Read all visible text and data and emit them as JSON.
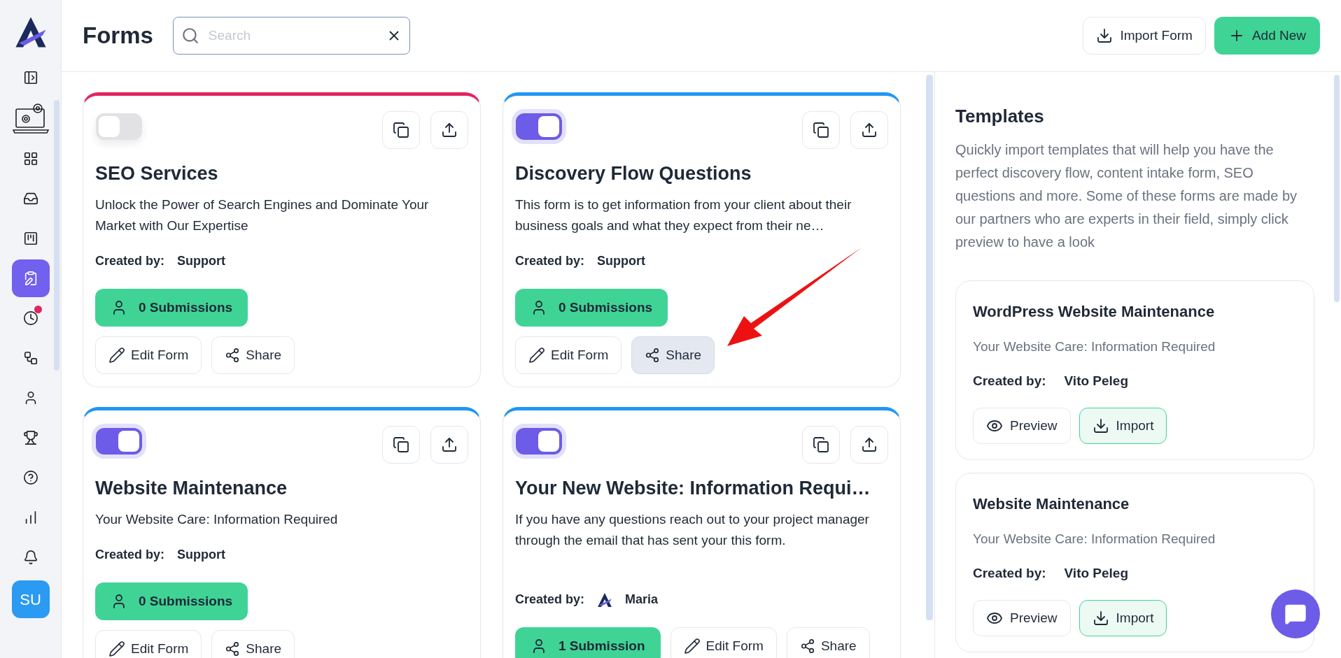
{
  "header": {
    "title": "Forms",
    "search": {
      "placeholder": "Search"
    },
    "import_button": "Import Form",
    "add_button": "Add New"
  },
  "sidebar": {
    "items": [
      {
        "kind": "panel",
        "selected": false,
        "badge": false
      },
      {
        "kind": "settings",
        "selected": false,
        "badge": false
      },
      {
        "kind": "grid",
        "selected": false,
        "badge": false
      },
      {
        "kind": "inbox",
        "selected": false,
        "badge": false
      },
      {
        "kind": "board",
        "selected": false,
        "badge": false
      },
      {
        "kind": "forms",
        "selected": true,
        "badge": false
      },
      {
        "kind": "clock",
        "selected": false,
        "badge": true
      },
      {
        "kind": "flow",
        "selected": false,
        "badge": false
      },
      {
        "kind": "user",
        "selected": false,
        "badge": false
      },
      {
        "kind": "trophy",
        "selected": false,
        "badge": false
      },
      {
        "kind": "help",
        "selected": false,
        "badge": false
      },
      {
        "kind": "chart",
        "selected": false,
        "badge": false
      },
      {
        "kind": "bell",
        "selected": false,
        "badge": false
      }
    ],
    "avatar": "SU"
  },
  "forms": [
    {
      "kind": "stacked",
      "color": "#e3245f",
      "on": false,
      "title": "SEO Services",
      "description": "Unlock the Power of Search Engines and Dominate Your Market with Our Expertise",
      "created_label": "Created by:",
      "author": "Support",
      "author_logo": false,
      "submissions": "0 Submissions",
      "edit": "Edit Form",
      "share": "Share",
      "share_highlighted": false
    },
    {
      "kind": "stacked",
      "color": "#2196f3",
      "on": true,
      "title": "Discovery Flow Questions",
      "description": "This form is to get information from your client about their business goals and what they expect from their ne…",
      "created_label": "Created by:",
      "author": "Support",
      "author_logo": false,
      "submissions": "0 Submissions",
      "edit": "Edit Form",
      "share": "Share",
      "share_highlighted": true
    },
    {
      "kind": "stacked",
      "color": "#2196f3",
      "on": true,
      "title": "Website Maintenance",
      "description": "Your Website Care: Information Required",
      "created_label": "Created by:",
      "author": "Support",
      "author_logo": false,
      "submissions": "0 Submissions",
      "edit": "Edit Form",
      "share": "Share",
      "share_highlighted": false
    },
    {
      "kind": "inline",
      "color": "#2196f3",
      "on": true,
      "title": "Your New Website: Information Requi…",
      "description": "If you have any questions reach out to your project manager through the email that has sent your this form.",
      "created_label": "Created by:",
      "author": "Maria",
      "author_logo": true,
      "submissions": "1 Submission",
      "edit": "Edit Form",
      "share": "Share",
      "share_highlighted": false
    }
  ],
  "templates": {
    "title": "Templates",
    "description": "Quickly import templates that will help you have the perfect discovery flow, content intake form, SEO questions and more. Some of these forms are made by our partners who are experts in their field, simply click preview to have a look",
    "items": [
      {
        "title": "WordPress Website Maintenance",
        "description": "Your Website Care: Information Required",
        "created_label": "Created by:",
        "author": "Vito Peleg",
        "preview": "Preview",
        "import": "Import"
      },
      {
        "title": "Website Maintenance",
        "description": "Your Website Care: Information Required",
        "created_label": "Created by:",
        "author": "Vito Peleg",
        "preview": "Preview",
        "import": "Import"
      }
    ]
  }
}
